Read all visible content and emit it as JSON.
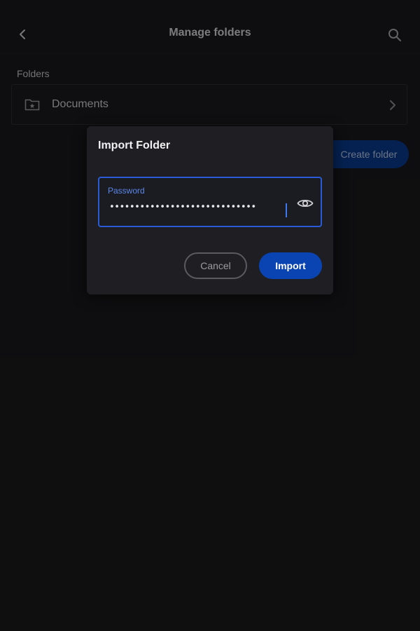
{
  "header": {
    "title": "Manage folders",
    "back_icon": "chevron-left-icon",
    "search_icon": "search-icon"
  },
  "folders": {
    "section_label": "Folders",
    "items": [
      {
        "name": "Documents",
        "icon": "folder-star-icon"
      }
    ],
    "create_label": "Create folder"
  },
  "dialog": {
    "title": "Import Folder",
    "password": {
      "label": "Password",
      "masked_value": "•••••••••••••••••••••••••••••"
    },
    "cancel_label": "Cancel",
    "import_label": "Import"
  },
  "colors": {
    "accent": "#2a5bd7",
    "primary_button": "#0a44b3",
    "background": "#19191c",
    "dialog_background": "#1f1f23"
  }
}
